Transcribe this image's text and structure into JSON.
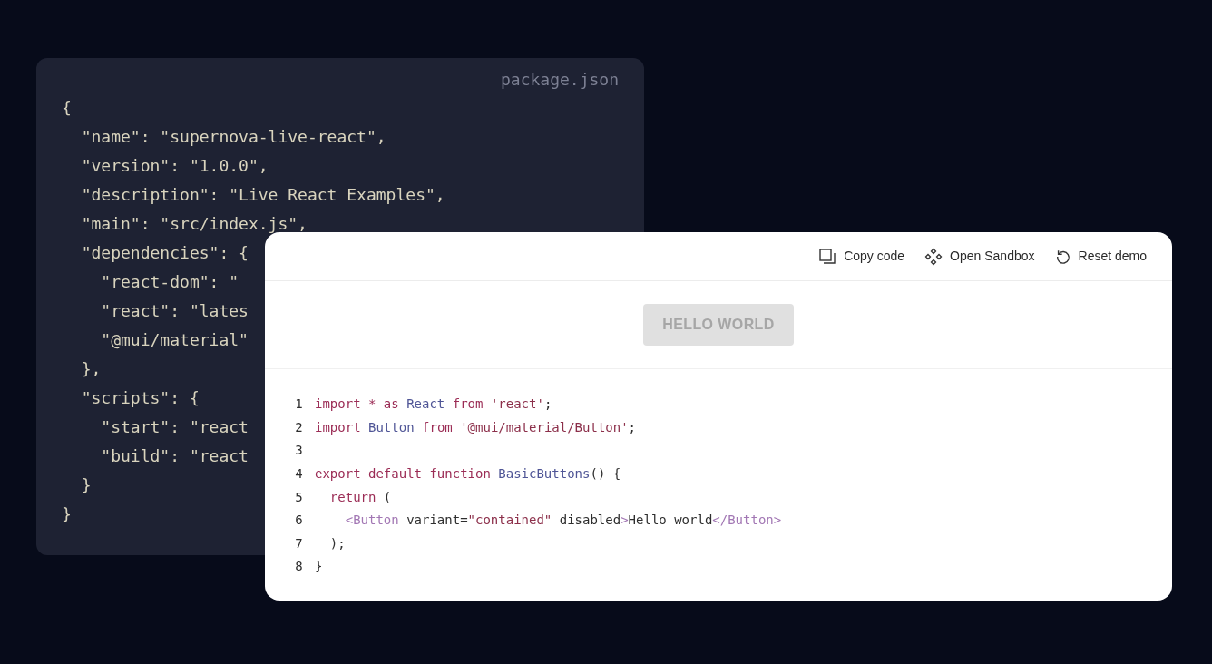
{
  "back_card": {
    "filename": "package.json",
    "lines": [
      "{",
      "  \"name\": \"supernova-live-react\",",
      "  \"version\": \"1.0.0\",",
      "  \"description\": \"Live React Examples\",",
      "  \"main\": \"src/index.js\",",
      "  \"dependencies\": {",
      "    \"react-dom\": \"",
      "    \"react\": \"lates",
      "    \"@mui/material\"",
      "  },",
      "  \"scripts\": {",
      "    \"start\": \"react",
      "    \"build\": \"react",
      "  }",
      "}"
    ]
  },
  "demo_card": {
    "toolbar": [
      {
        "kind": "copy",
        "label": "Copy code"
      },
      {
        "kind": "sandbox",
        "label": "Open Sandbox"
      },
      {
        "kind": "reset",
        "label": "Reset demo"
      }
    ],
    "preview_button": {
      "label": "HELLO WORLD",
      "disabled": true
    },
    "code": [
      {
        "number": "1",
        "tokens": [
          {
            "kind": "keyword",
            "text": "import * as "
          },
          {
            "kind": "name",
            "text": "React"
          },
          {
            "kind": "keyword",
            "text": " from "
          },
          {
            "kind": "string",
            "text": "'react'"
          },
          {
            "kind": "plain",
            "text": ";"
          }
        ]
      },
      {
        "number": "2",
        "tokens": [
          {
            "kind": "keyword",
            "text": "import "
          },
          {
            "kind": "name",
            "text": "Button"
          },
          {
            "kind": "keyword",
            "text": " from "
          },
          {
            "kind": "string",
            "text": "'@mui/material/Button'"
          },
          {
            "kind": "plain",
            "text": ";"
          }
        ]
      },
      {
        "number": "3"
      },
      {
        "number": "4",
        "tokens": [
          {
            "kind": "keyword",
            "text": "export default function "
          },
          {
            "kind": "name",
            "text": "BasicButtons"
          },
          {
            "kind": "plain",
            "text": "() {"
          }
        ]
      },
      {
        "number": "5",
        "tokens": [
          {
            "kind": "keyword",
            "text": "  return "
          },
          {
            "kind": "plain",
            "text": "("
          }
        ]
      },
      {
        "number": "6",
        "tokens": [
          {
            "kind": "tag",
            "text": "    <Button"
          },
          {
            "kind": "plain",
            "text": " variant="
          },
          {
            "kind": "string",
            "text": "\"contained\""
          },
          {
            "kind": "plain",
            "text": " disabled"
          },
          {
            "kind": "tag",
            "text": ">"
          },
          {
            "kind": "plain",
            "text": "Hello world"
          },
          {
            "kind": "tag",
            "text": "</Button>"
          }
        ]
      },
      {
        "number": "7",
        "tokens": [
          {
            "kind": "plain",
            "text": "  );"
          }
        ]
      },
      {
        "number": "8",
        "tokens": [
          {
            "kind": "plain",
            "text": "}"
          }
        ]
      }
    ]
  }
}
